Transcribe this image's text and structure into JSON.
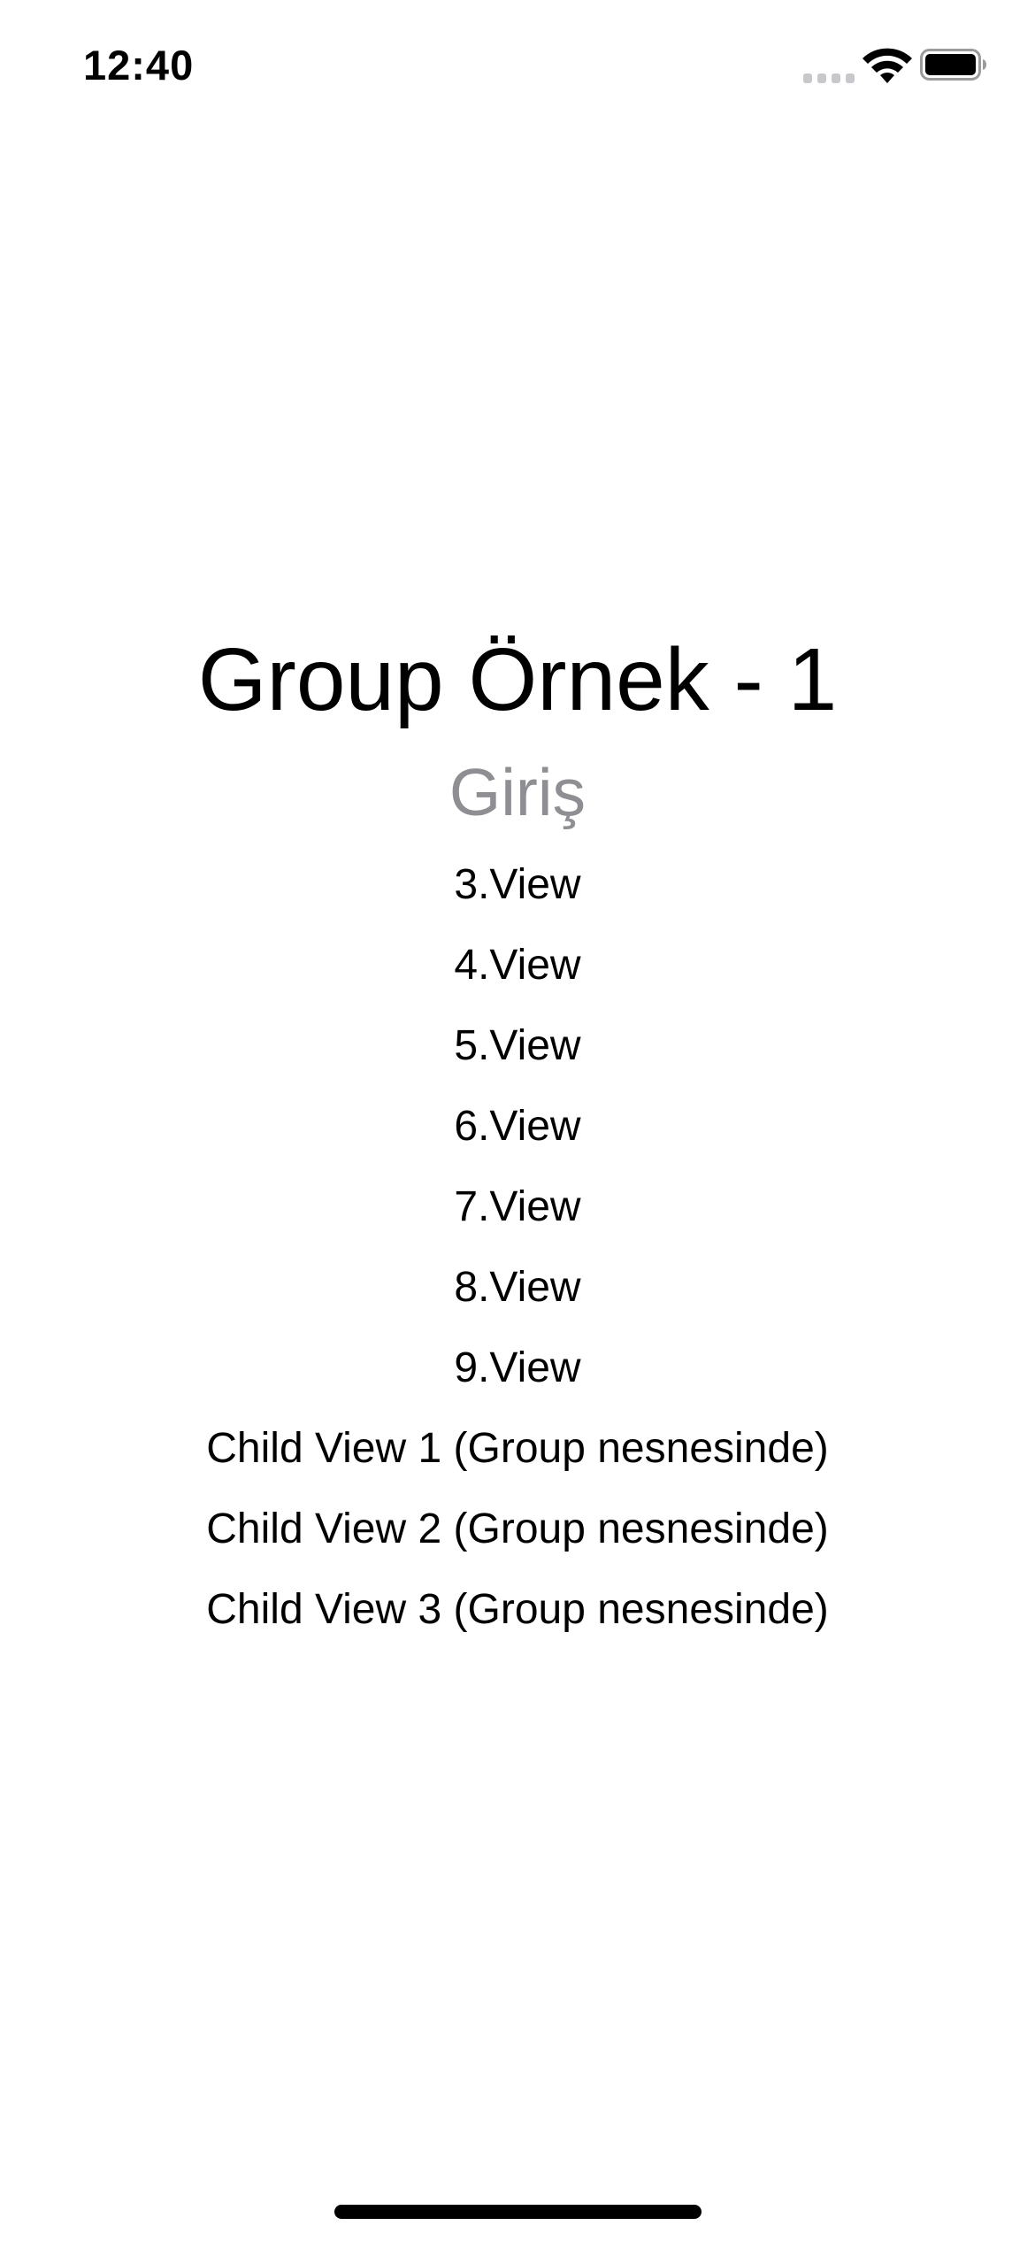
{
  "status_bar": {
    "time": "12:40"
  },
  "main": {
    "title": "Group Örnek - 1",
    "subtitle": "Giriş",
    "views": [
      "3.View",
      "4.View",
      "5.View",
      "6.View",
      "7.View",
      "8.View",
      "9.View",
      "Child View 1 (Group nesnesinde)",
      "Child View 2 (Group nesnesinde)",
      "Child View 3 (Group nesnesinde)"
    ]
  },
  "colors": {
    "background": "#ffffff",
    "text": "#000000",
    "subtitle": "#8e8e93"
  },
  "icons": {
    "signal": "cellular-signal-icon",
    "wifi": "wifi-icon",
    "battery": "battery-icon"
  }
}
